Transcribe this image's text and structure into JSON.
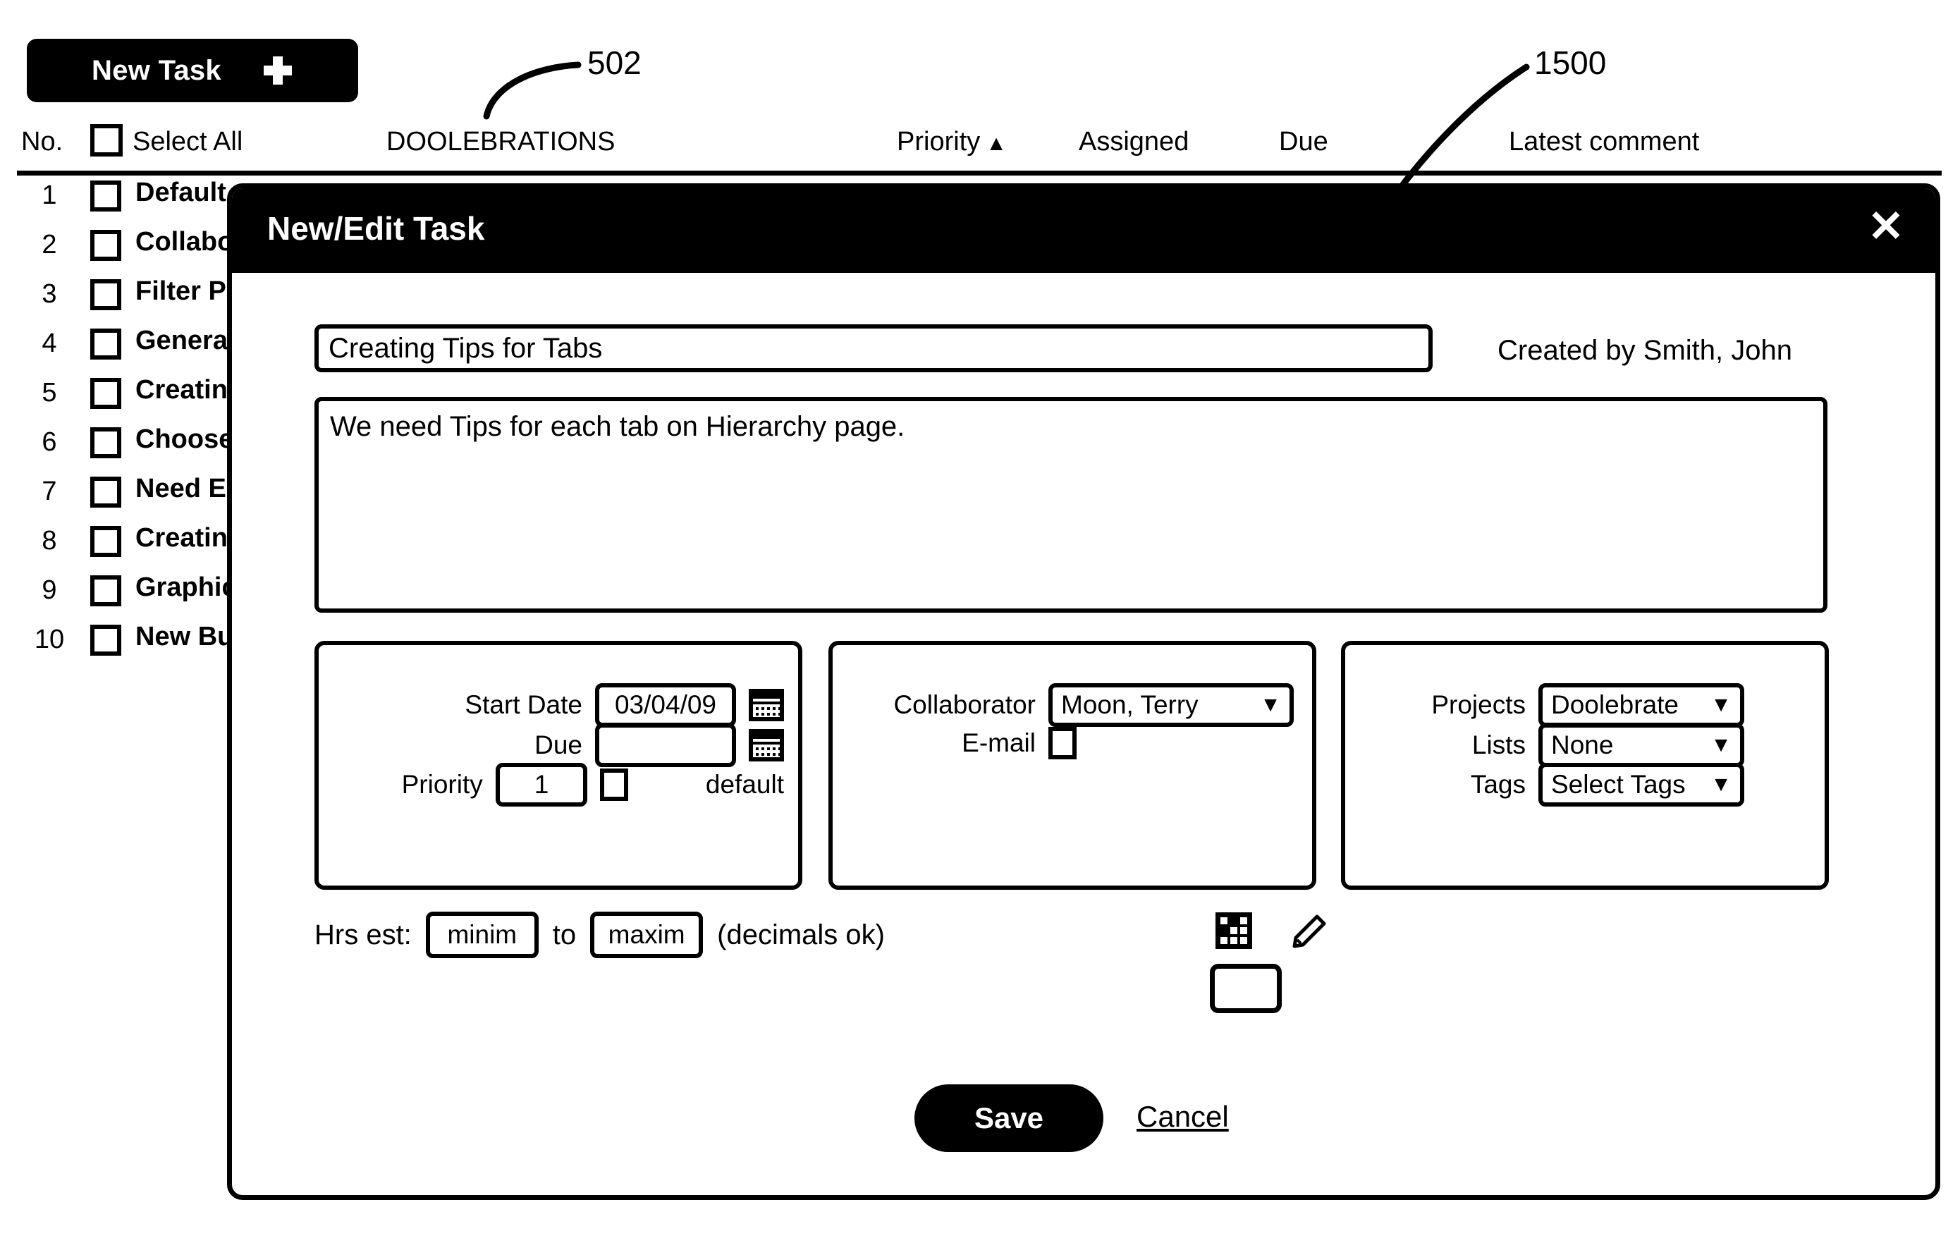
{
  "page": {
    "new_task_button": {
      "label": "New Task",
      "icon": "plus-icon"
    },
    "columns": {
      "no": "No.",
      "select_all": "Select All",
      "project": "DOOLEBRATIONS",
      "priority": "Priority",
      "priority_sort_caret": "▲",
      "assigned": "Assigned",
      "due": "Due",
      "latest_comment": "Latest comment"
    },
    "rows": [
      {
        "no": "1",
        "label": "Default"
      },
      {
        "no": "2",
        "label": "Collabo"
      },
      {
        "no": "3",
        "label": "Filter Pą"
      },
      {
        "no": "4",
        "label": "Genera"
      },
      {
        "no": "5",
        "label": "Creating"
      },
      {
        "no": "6",
        "label": "Choose"
      },
      {
        "no": "7",
        "label": "Need E"
      },
      {
        "no": "8",
        "label": "Creating"
      },
      {
        "no": "9",
        "label": "Graphic"
      },
      {
        "no": "10",
        "label": "New Bu"
      }
    ]
  },
  "reference_numerals": {
    "list_view": "502",
    "dialog": "1500"
  },
  "modal": {
    "title": "New/Edit Task",
    "close_icon_label": "✕",
    "task_title": "Creating Tips for Tabs",
    "created_by": "Created by Smith, John",
    "description": "We need Tips for each tab on Hierarchy page.",
    "schedule": {
      "start_date_label": "Start Date",
      "start_date_value": "03/04/09",
      "due_label": "Due",
      "due_value": "",
      "priority_label": "Priority",
      "priority_value": "1",
      "default_label": "default",
      "default_checked": false
    },
    "collaborate": {
      "collaborator_label": "Collaborator",
      "collaborator_value": "Moon, Terry",
      "email_label": "E-mail",
      "email_checked": false
    },
    "organize": {
      "projects_label": "Projects",
      "projects_value": "Doolebrate",
      "lists_label": "Lists",
      "lists_value": "None",
      "tags_label": "Tags",
      "tags_value": "Select Tags"
    },
    "hours": {
      "label": "Hrs est:",
      "min_placeholder": "minim",
      "max_placeholder": "maxim",
      "between_label": "to",
      "note": "(decimals ok)"
    },
    "footer": {
      "save_label": "Save",
      "cancel_label": "Cancel"
    },
    "caret_glyph": "▼"
  }
}
